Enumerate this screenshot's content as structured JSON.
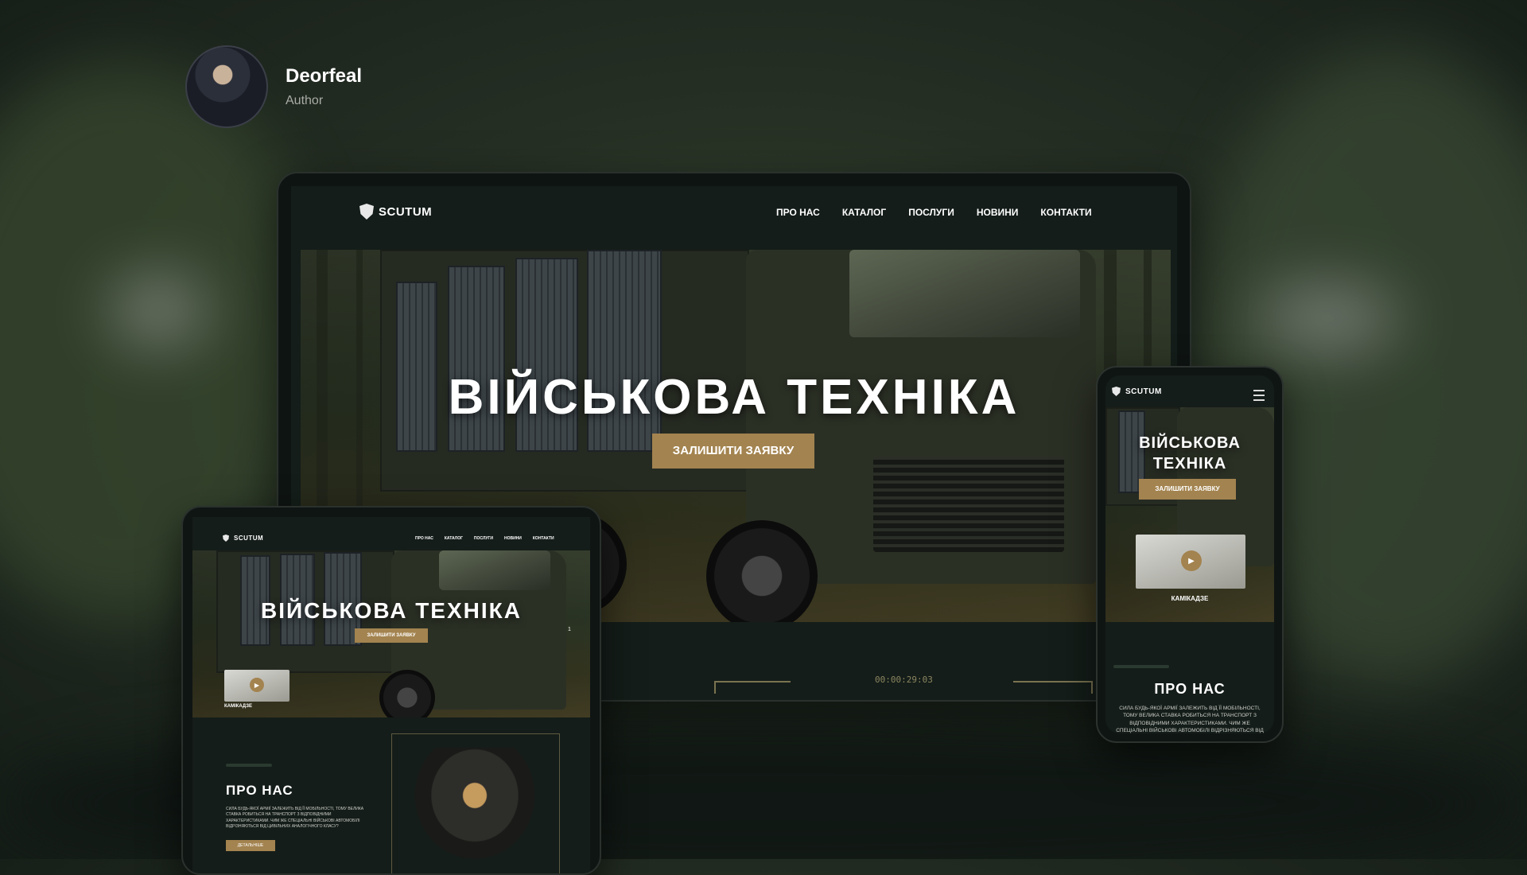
{
  "author": {
    "name": "Deorfeal",
    "role": "Author"
  },
  "site": {
    "brand": "SCUTUM",
    "nav": [
      "ПРО НАС",
      "КАТАЛОГ",
      "ПОСЛУГИ",
      "НОВИНИ",
      "КОНТАКТИ"
    ],
    "hero_title": "ВІЙСЬКОВА ТЕХНІКА",
    "hero_title_mobile_1": "ВІЙСЬКОВА",
    "hero_title_mobile_2": "ТЕХНІКА",
    "cta": "ЗАЛИШИТИ ЗАЯВКУ",
    "timer": "00:00:29:03",
    "slide_counter": "1",
    "video_label": "КАМІКАДЗЕ",
    "about_title": "ПРО НАС",
    "about_text_tablet": "СИЛА БУДЬ-ЯКОЇ АРМІЇ ЗАЛЕЖИТЬ ВІД ЇЇ МОБІЛЬНОСТІ, ТОМУ ВЕЛИКА СТАВКА РОБИТЬСЯ НА ТРАНСПОРТ З ВІДПОВІДНИМИ ХАРАКТЕРИСТИКАМИ. ЧИМ ЖЕ СПЕЦІАЛЬНІ ВІЙСЬКОВІ АВТОМОБІЛІ ВІДРІЗНЯЮТЬСЯ ВІД ЦИВІЛЬНИХ АНАЛОГІЧНОГО КЛАСУ?",
    "about_text_phone": "СИЛА БУДЬ-ЯКОЇ АРМІЇ ЗАЛЕЖИТЬ ВІД ЇЇ МОБІЛЬНОСТІ, ТОМУ ВЕЛИКА СТАВКА РОБИТЬСЯ НА ТРАНСПОРТ З ВІДПОВІДНИМИ ХАРАКТЕРИСТИКАМИ. ЧИМ ЖЕ СПЕЦІАЛЬНІ ВІЙСЬКОВІ АВТОМОБІЛІ ВІДРІЗНЯЮТЬСЯ ВІД ЦИВІЛЬНИХ АНАЛОГІЧНОГО КЛАСУ?",
    "details_button": "ДЕТАЛЬНІШЕ"
  },
  "colors": {
    "accent": "#a3834f",
    "bg": "#141d19",
    "text": "#ffffff"
  }
}
